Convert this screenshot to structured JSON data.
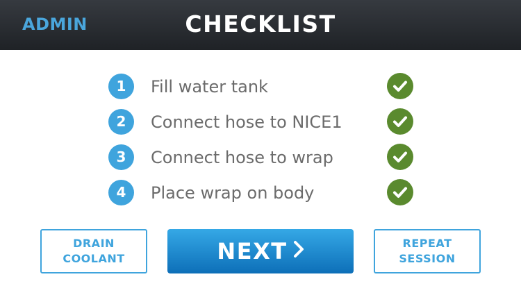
{
  "header": {
    "admin_label": "ADMIN",
    "title": "CHECKLIST"
  },
  "checklist": {
    "items": [
      {
        "number": "1",
        "label": "Fill water tank",
        "done": true
      },
      {
        "number": "2",
        "label": "Connect hose to NICE1",
        "done": true
      },
      {
        "number": "3",
        "label": "Connect hose to wrap",
        "done": true
      },
      {
        "number": "4",
        "label": "Place wrap on body",
        "done": true
      }
    ]
  },
  "actions": {
    "drain_line1": "DRAIN",
    "drain_line2": "COOLANT",
    "next_label": "NEXT",
    "next_icon": "chevron-right-icon",
    "repeat_line1": "REPEAT",
    "repeat_line2": "SESSION"
  },
  "colors": {
    "accent": "#3fa4dd",
    "header_bg": "#2b2e33",
    "check_green": "#5a8a2e",
    "label_gray": "#6b6b6b"
  }
}
